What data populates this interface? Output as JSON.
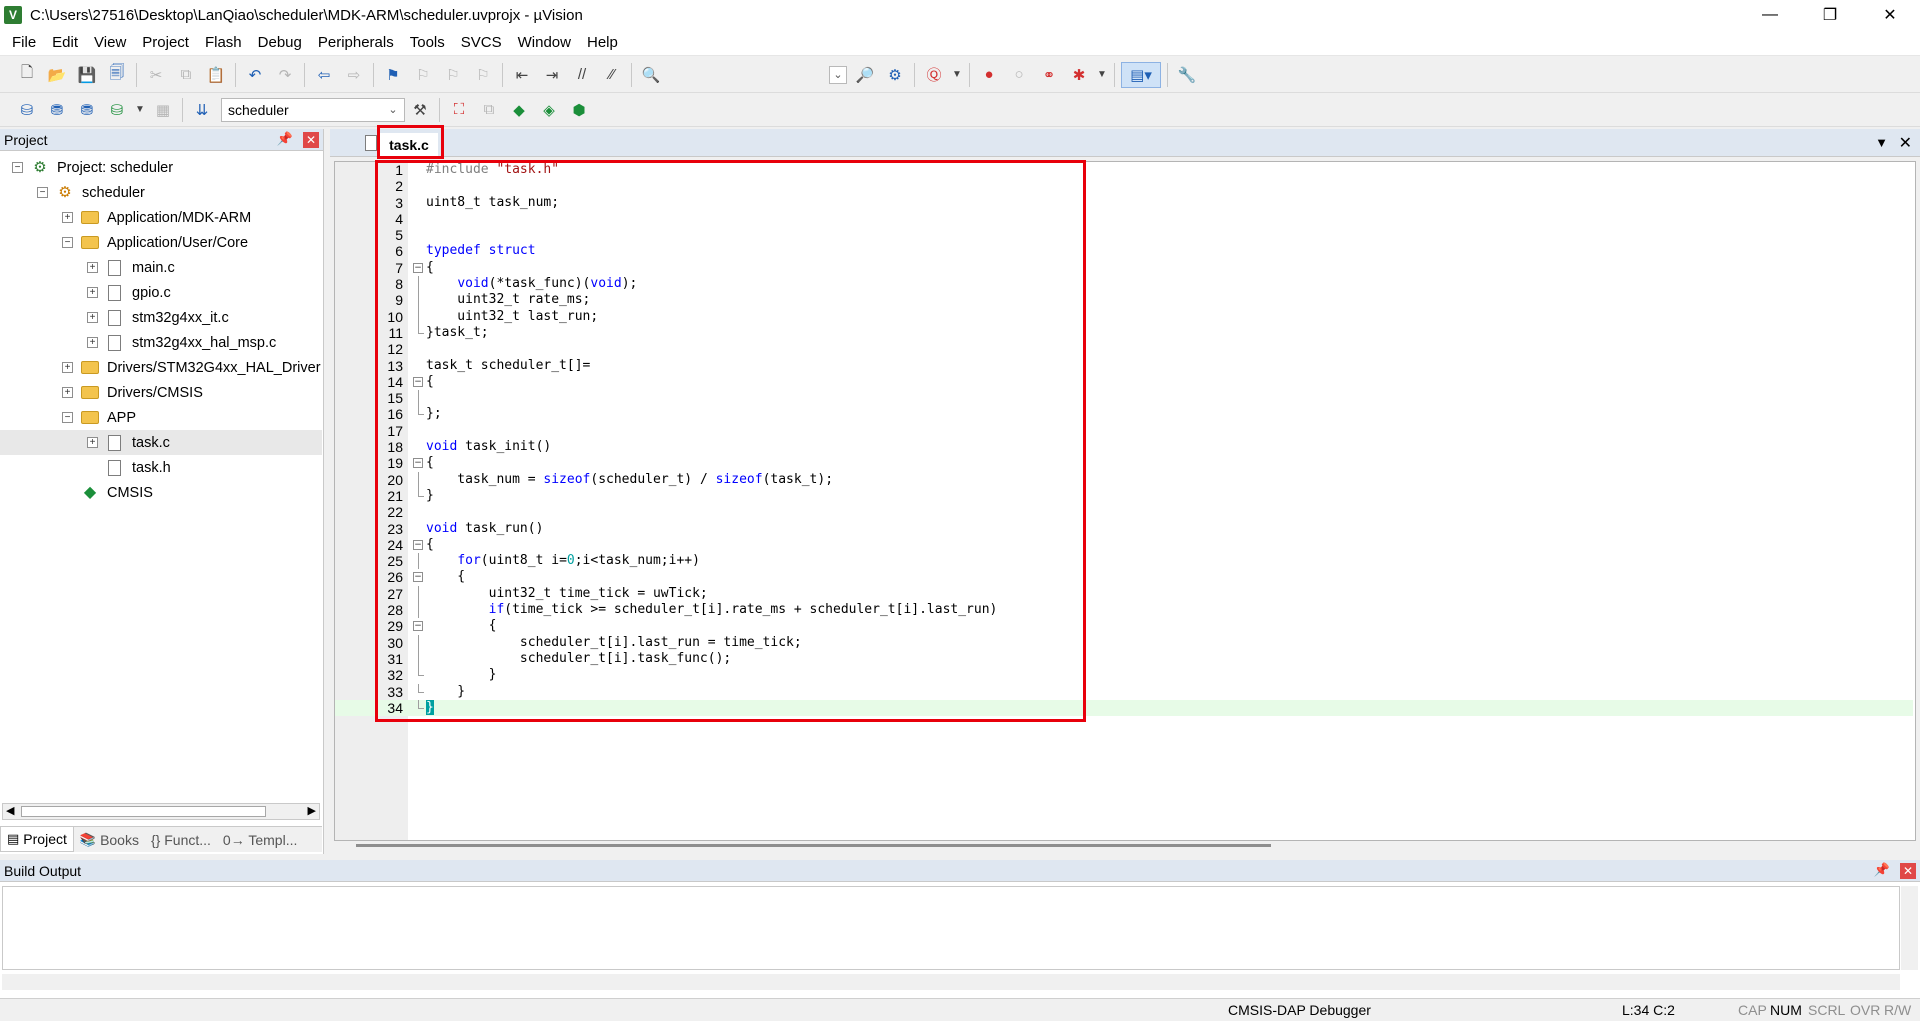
{
  "window": {
    "title": "C:\\Users\\27516\\Desktop\\LanQiao\\scheduler\\MDK-ARM\\scheduler.uvprojx - µVision",
    "min": "—",
    "restore": "❐",
    "close": "✕"
  },
  "menu": [
    "File",
    "Edit",
    "View",
    "Project",
    "Flash",
    "Debug",
    "Peripherals",
    "Tools",
    "SVCS",
    "Window",
    "Help"
  ],
  "toolbar2": {
    "target": "scheduler"
  },
  "project_panel": {
    "title": "Project",
    "tree": [
      {
        "label": "Project: scheduler",
        "depth": 0,
        "expander": "−",
        "icon": "project"
      },
      {
        "label": "scheduler",
        "depth": 1,
        "expander": "−",
        "icon": "target"
      },
      {
        "label": "Application/MDK-ARM",
        "depth": 2,
        "expander": "+",
        "icon": "folder"
      },
      {
        "label": "Application/User/Core",
        "depth": 2,
        "expander": "−",
        "icon": "folder"
      },
      {
        "label": "main.c",
        "depth": 3,
        "expander": "+",
        "icon": "file"
      },
      {
        "label": "gpio.c",
        "depth": 3,
        "expander": "+",
        "icon": "file"
      },
      {
        "label": "stm32g4xx_it.c",
        "depth": 3,
        "expander": "+",
        "icon": "file"
      },
      {
        "label": "stm32g4xx_hal_msp.c",
        "depth": 3,
        "expander": "+",
        "icon": "file"
      },
      {
        "label": "Drivers/STM32G4xx_HAL_Driver",
        "depth": 2,
        "expander": "+",
        "icon": "folder"
      },
      {
        "label": "Drivers/CMSIS",
        "depth": 2,
        "expander": "+",
        "icon": "folder"
      },
      {
        "label": "APP",
        "depth": 2,
        "expander": "−",
        "icon": "folder"
      },
      {
        "label": "task.c",
        "depth": 3,
        "expander": "+",
        "icon": "file",
        "selected": true
      },
      {
        "label": "task.h",
        "depth": 3,
        "expander": "",
        "icon": "file"
      },
      {
        "label": "CMSIS",
        "depth": 2,
        "expander": "",
        "icon": "diamond"
      }
    ],
    "tabs": [
      "Project",
      "Books",
      "{} Funct...",
      "0→ Templ..."
    ]
  },
  "editor": {
    "tab": "task.c",
    "cursor_line": 34,
    "lines": [
      "#include \"task.h\"",
      "",
      "uint8_t task_num;",
      "",
      "",
      "typedef struct",
      "{",
      "    void(*task_func)(void);",
      "    uint32_t rate_ms;",
      "    uint32_t last_run;",
      "}task_t;",
      "",
      "task_t scheduler_t[]=",
      "{",
      "",
      "};",
      "",
      "void task_init()",
      "{",
      "    task_num = sizeof(scheduler_t) / sizeof(task_t);",
      "}",
      "",
      "void task_run()",
      "{",
      "    for(uint8_t i=0;i<task_num;i++)",
      "    {",
      "        uint32_t time_tick = uwTick;",
      "        if(time_tick >= scheduler_t[i].rate_ms + scheduler_t[i].last_run)",
      "        {",
      "            scheduler_t[i].last_run = time_tick;",
      "            scheduler_t[i].task_func();",
      "        }",
      "    }",
      "}"
    ]
  },
  "build_output": {
    "title": "Build Output"
  },
  "statusbar": {
    "debugger": "CMSIS-DAP Debugger",
    "position": "L:34 C:2",
    "cap": "CAP",
    "num": "NUM",
    "scrl": "SCRL",
    "ovr": "OVR",
    "rw": "R/W"
  },
  "colors": {
    "highlight": "#e8000b",
    "keyword": "#0000ff",
    "string": "#a31515",
    "number": "#00a0a0",
    "current_line": "#e7fbe7"
  }
}
